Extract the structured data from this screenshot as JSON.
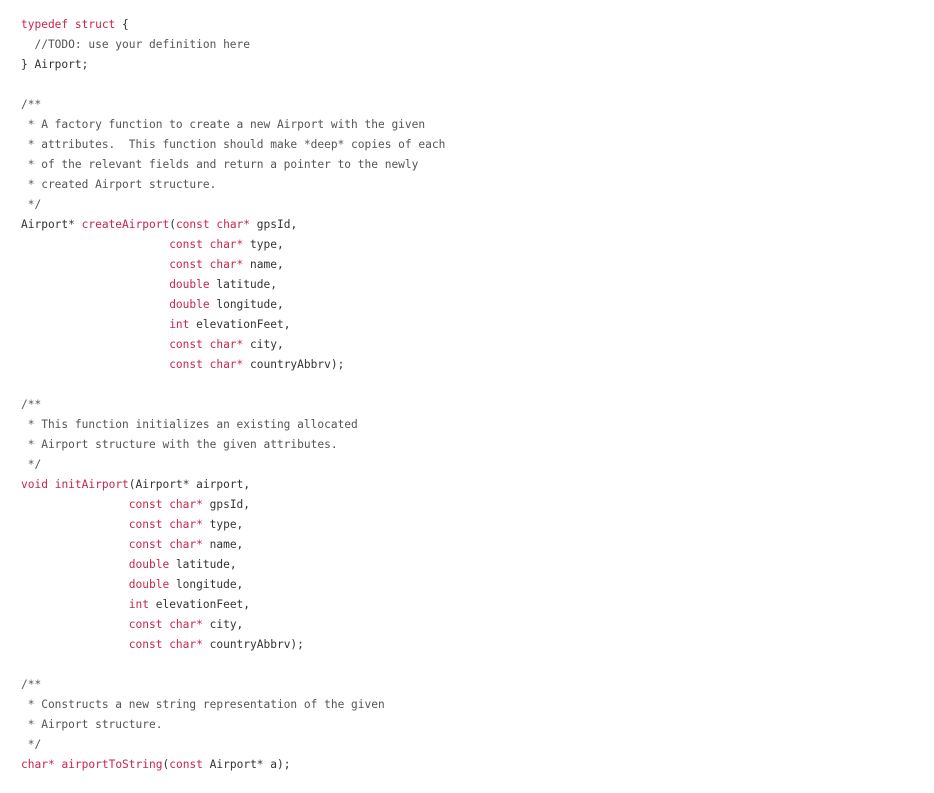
{
  "colors": {
    "background": "#ffffff",
    "plain_text": "#333333",
    "keyword": "#c7254e",
    "function_name": "#c7254e",
    "comment": "#555555"
  },
  "code": {
    "language": "c",
    "lines": [
      [
        [
          "kw",
          "typedef struct"
        ],
        [
          "pu",
          " {"
        ]
      ],
      [
        [
          "cm",
          "  //TODO: use your definition here"
        ]
      ],
      [
        [
          "pu",
          "} Airport;"
        ]
      ],
      [],
      [
        [
          "cm",
          "/**"
        ]
      ],
      [
        [
          "cm",
          " * A factory function to create a new Airport with the given"
        ]
      ],
      [
        [
          "cm",
          " * attributes.  This function should make *deep* copies of each"
        ]
      ],
      [
        [
          "cm",
          " * of the relevant fields and return a pointer to the newly"
        ]
      ],
      [
        [
          "cm",
          " * created Airport structure."
        ]
      ],
      [
        [
          "cm",
          " */"
        ]
      ],
      [
        [
          "id",
          "Airport* "
        ],
        [
          "fn",
          "createAirport"
        ],
        [
          "pu",
          "("
        ],
        [
          "kw",
          "const char*"
        ],
        [
          "id",
          " gpsId,"
        ]
      ],
      [
        [
          "id",
          "                      "
        ],
        [
          "kw",
          "const char*"
        ],
        [
          "id",
          " type,"
        ]
      ],
      [
        [
          "id",
          "                      "
        ],
        [
          "kw",
          "const char*"
        ],
        [
          "id",
          " name,"
        ]
      ],
      [
        [
          "id",
          "                      "
        ],
        [
          "kw",
          "double"
        ],
        [
          "id",
          " latitude,"
        ]
      ],
      [
        [
          "id",
          "                      "
        ],
        [
          "kw",
          "double"
        ],
        [
          "id",
          " longitude,"
        ]
      ],
      [
        [
          "id",
          "                      "
        ],
        [
          "kw",
          "int"
        ],
        [
          "id",
          " elevationFeet,"
        ]
      ],
      [
        [
          "id",
          "                      "
        ],
        [
          "kw",
          "const char*"
        ],
        [
          "id",
          " city,"
        ]
      ],
      [
        [
          "id",
          "                      "
        ],
        [
          "kw",
          "const char*"
        ],
        [
          "id",
          " countryAbbrv);"
        ]
      ],
      [],
      [
        [
          "cm",
          "/**"
        ]
      ],
      [
        [
          "cm",
          " * This function initializes an existing allocated"
        ]
      ],
      [
        [
          "cm",
          " * Airport structure with the given attributes."
        ]
      ],
      [
        [
          "cm",
          " */"
        ]
      ],
      [
        [
          "kw",
          "void"
        ],
        [
          "id",
          " "
        ],
        [
          "fn",
          "initAirport"
        ],
        [
          "pu",
          "("
        ],
        [
          "id",
          "Airport* airport,"
        ]
      ],
      [
        [
          "id",
          "                "
        ],
        [
          "kw",
          "const char*"
        ],
        [
          "id",
          " gpsId,"
        ]
      ],
      [
        [
          "id",
          "                "
        ],
        [
          "kw",
          "const char*"
        ],
        [
          "id",
          " type,"
        ]
      ],
      [
        [
          "id",
          "                "
        ],
        [
          "kw",
          "const char*"
        ],
        [
          "id",
          " name,"
        ]
      ],
      [
        [
          "id",
          "                "
        ],
        [
          "kw",
          "double"
        ],
        [
          "id",
          " latitude,"
        ]
      ],
      [
        [
          "id",
          "                "
        ],
        [
          "kw",
          "double"
        ],
        [
          "id",
          " longitude,"
        ]
      ],
      [
        [
          "id",
          "                "
        ],
        [
          "kw",
          "int"
        ],
        [
          "id",
          " elevationFeet,"
        ]
      ],
      [
        [
          "id",
          "                "
        ],
        [
          "kw",
          "const char*"
        ],
        [
          "id",
          " city,"
        ]
      ],
      [
        [
          "id",
          "                "
        ],
        [
          "kw",
          "const char*"
        ],
        [
          "id",
          " countryAbbrv);"
        ]
      ],
      [],
      [
        [
          "cm",
          "/**"
        ]
      ],
      [
        [
          "cm",
          " * Constructs a new string representation of the given"
        ]
      ],
      [
        [
          "cm",
          " * Airport structure."
        ]
      ],
      [
        [
          "cm",
          " */"
        ]
      ],
      [
        [
          "kw",
          "char*"
        ],
        [
          "id",
          " "
        ],
        [
          "fn",
          "airportToString"
        ],
        [
          "pu",
          "("
        ],
        [
          "kw",
          "const"
        ],
        [
          "id",
          " Airport* a);"
        ]
      ]
    ]
  }
}
